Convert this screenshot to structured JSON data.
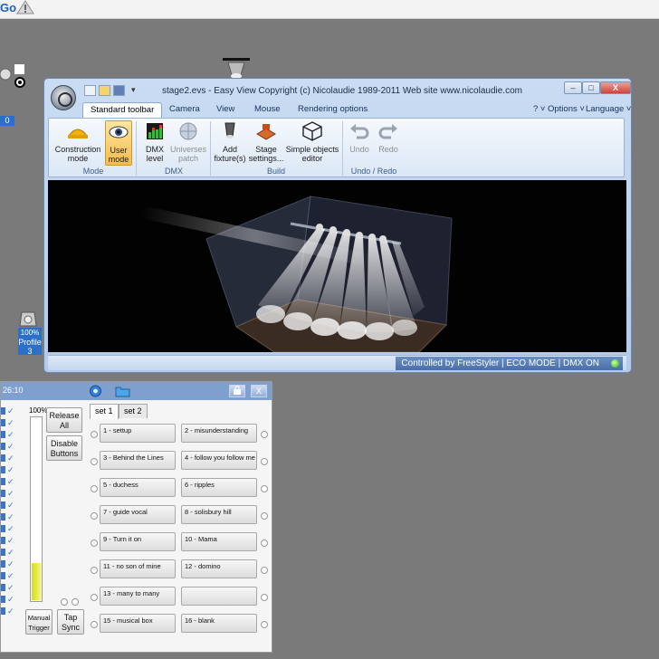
{
  "topbar": {
    "go_label": "Go"
  },
  "left_widgets": {
    "blue_tag": "0",
    "profile_label": "Profile",
    "profile_number": "3",
    "profile_percent": "100%"
  },
  "easyview": {
    "title": "stage2.evs - Easy View   Copyright (c) Nicolaudie 1989-2011   Web site www.nicolaudie.com",
    "tabs": [
      {
        "label": "Standard toolbar",
        "active": true
      },
      {
        "label": "Camera",
        "active": false
      },
      {
        "label": "View",
        "active": false
      },
      {
        "label": "Mouse",
        "active": false
      },
      {
        "label": "Rendering options",
        "active": false
      }
    ],
    "menu_help": "? ˅",
    "menu_options": "Options ˅",
    "menu_language": "Language ˅",
    "groups": {
      "mode": "Mode",
      "dmx": "DMX",
      "build": "Build",
      "undo_redo": "Undo / Redo"
    },
    "buttons": {
      "construction_mode": [
        "Construction",
        "mode"
      ],
      "user_mode": [
        "User",
        "mode"
      ],
      "dmx_level": [
        "DMX",
        "level"
      ],
      "universes_patch": [
        "Universes",
        "patch"
      ],
      "add_fixture": [
        "Add",
        "fixture(s)"
      ],
      "stage_settings": [
        "Stage",
        "settings..."
      ],
      "simple_objects_editor": [
        "Simple objects",
        "editor"
      ],
      "undo": "Undo",
      "redo": "Redo"
    },
    "status": "Controlled by FreeStyler  |  ECO MODE  |  DMX ON",
    "colors": {
      "accent": "#4a6fa8",
      "selected": "#f6bd4c"
    }
  },
  "panel": {
    "time": "26:10",
    "level_percent": "100%",
    "fader_level": 0.2,
    "release_all": [
      "Release",
      "All"
    ],
    "disable_buttons": [
      "Disable",
      "Buttons"
    ],
    "manual_trigger": [
      "Manual",
      "Trigger"
    ],
    "tap_sync": [
      "Tap",
      "Sync"
    ],
    "set_tabs": [
      {
        "label": "set 1",
        "active": true
      },
      {
        "label": "set 2",
        "active": false
      }
    ],
    "sequences": [
      "1 - settup",
      "2 - misunderstanding",
      "3 - Behind the Lines",
      "4 - follow you follow me",
      "5 - duchess",
      "6 - ripples",
      "7 - guide vocal",
      "8 - solisbury hill",
      "9 - Turn it on",
      "10 - Mama",
      "11 - no son of mine",
      "12 - domino",
      "13 - many to many",
      "",
      "15 - musical box",
      "16 - blank"
    ]
  }
}
